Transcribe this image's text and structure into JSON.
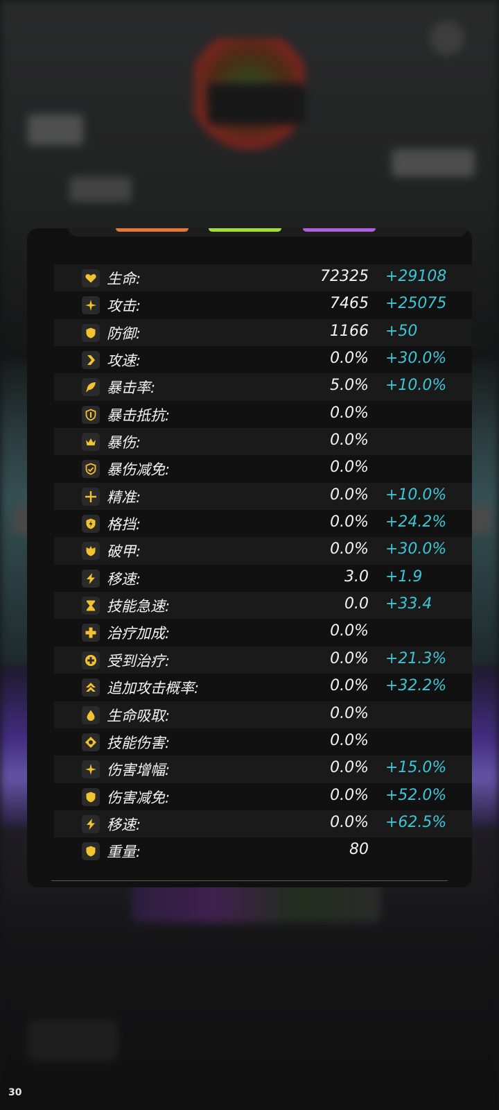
{
  "fps": "30",
  "stats": [
    {
      "label": "生命:",
      "base": "72325",
      "bonus": "+29108",
      "icon": "heart-icon"
    },
    {
      "label": "攻击:",
      "base": "7465",
      "bonus": "+25075",
      "icon": "sparkle-icon"
    },
    {
      "label": "防御:",
      "base": "1166",
      "bonus": "+50",
      "icon": "shield-icon"
    },
    {
      "label": "攻速:",
      "base": "0.0%",
      "bonus": "+30.0%",
      "icon": "chevron-right-icon"
    },
    {
      "label": "暴击率:",
      "base": "5.0%",
      "bonus": "+10.0%",
      "icon": "feather-icon"
    },
    {
      "label": "暴击抵抗:",
      "base": "0.0%",
      "bonus": "",
      "icon": "shield-outline-icon"
    },
    {
      "label": "暴伤:",
      "base": "0.0%",
      "bonus": "",
      "icon": "crown-icon"
    },
    {
      "label": "暴伤减免:",
      "base": "0.0%",
      "bonus": "",
      "icon": "shield-check-icon"
    },
    {
      "label": "精准:",
      "base": "0.0%",
      "bonus": "+10.0%",
      "icon": "crosshair-icon"
    },
    {
      "label": "格挡:",
      "base": "0.0%",
      "bonus": "+24.2%",
      "icon": "shield-bolt-icon"
    },
    {
      "label": "破甲:",
      "base": "0.0%",
      "bonus": "+30.0%",
      "icon": "broken-shield-icon"
    },
    {
      "label": "移速:",
      "base": "3.0",
      "bonus": "+1.9",
      "icon": "lightning-icon"
    },
    {
      "label": "技能急速:",
      "base": "0.0",
      "bonus": "+33.4",
      "icon": "hourglass-icon"
    },
    {
      "label": "治疗加成:",
      "base": "0.0%",
      "bonus": "",
      "icon": "plus-icon"
    },
    {
      "label": "受到治疗:",
      "base": "0.0%",
      "bonus": "+21.3%",
      "icon": "plus-circle-icon"
    },
    {
      "label": "追加攻击概率:",
      "base": "0.0%",
      "bonus": "+32.2%",
      "icon": "double-chevron-up-icon"
    },
    {
      "label": "生命吸取:",
      "base": "0.0%",
      "bonus": "",
      "icon": "drop-icon"
    },
    {
      "label": "技能伤害:",
      "base": "0.0%",
      "bonus": "",
      "icon": "diamond-gear-icon"
    },
    {
      "label": "伤害增幅:",
      "base": "0.0%",
      "bonus": "+15.0%",
      "icon": "sparkle-icon"
    },
    {
      "label": "伤害减免:",
      "base": "0.0%",
      "bonus": "+52.0%",
      "icon": "shield-icon"
    },
    {
      "label": "移速:",
      "base": "0.0%",
      "bonus": "+62.5%",
      "icon": "lightning-icon"
    },
    {
      "label": "重量:",
      "base": "80",
      "bonus": "",
      "icon": "shield-icon"
    }
  ]
}
